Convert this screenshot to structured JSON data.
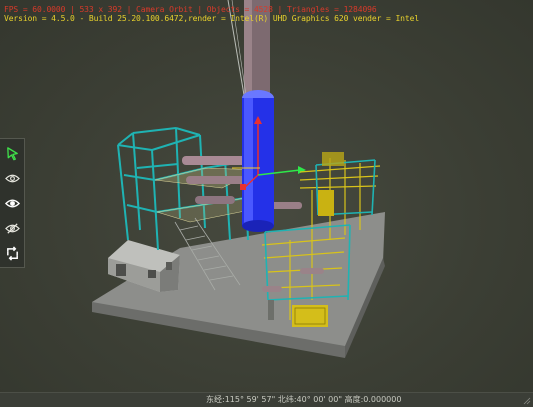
{
  "viewer": {
    "debug_line1": "FPS = 60.0000 | 533 x 392 | Camera Orbit | Objects = 4528 | Triangles = 1284096",
    "debug_line2": "Version = 4.5.0 - Build 25.20.100.6472,render =  Intel(R) UHD Graphics 620  vender = Intel"
  },
  "toolbar": {
    "items": [
      {
        "name": "select-tool",
        "icon": "cursor-arrow-icon"
      },
      {
        "name": "show-tool",
        "icon": "eye-outline-icon"
      },
      {
        "name": "show-all-tool",
        "icon": "eye-filled-icon"
      },
      {
        "name": "hide-tool",
        "icon": "eye-slash-icon"
      },
      {
        "name": "reset-tool",
        "icon": "reset-rotate-icon"
      }
    ]
  },
  "status": {
    "coordinates": "东经:115° 59' 57\"  北纬:40° 00' 00\"  高度:0.000000"
  },
  "colors": {
    "background": "#3b3e34",
    "steel_frame": "#1fb3b3",
    "column": "#2b3df0",
    "piping": "#d8c31a",
    "slab": "#8b8c8a",
    "debug_red": "#d83a2a",
    "debug_yellow": "#e8d22c"
  }
}
